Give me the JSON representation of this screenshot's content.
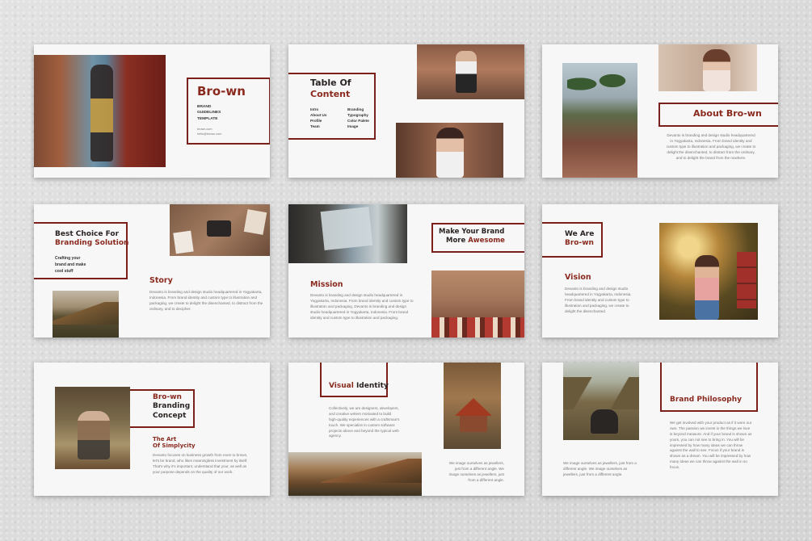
{
  "colors": {
    "accent": "#7a1f1a",
    "accent_text": "#8a2a1f",
    "dark_text": "#2a2322",
    "slide_bg": "#f7f7f7",
    "backdrop": "#dcdcdc"
  },
  "slide1": {
    "title": "Bro-wn",
    "subtitle_lines": [
      "BRAND",
      "GUIDELINES",
      "TEMPLATE"
    ],
    "website": "brown.com",
    "email": "hello@brown.com",
    "photo_alt": "woman-on-shipping-containers-photo"
  },
  "slide2": {
    "title_line1": "Table Of",
    "title_line2": "Content",
    "col1": [
      "Intro",
      "About Us",
      "Profile",
      "Team"
    ],
    "col2": [
      "Branding",
      "Typography",
      "Color Palete",
      "Image"
    ]
  },
  "slide3": {
    "title_prefix": "About ",
    "title_brand": "Bro-wn",
    "body": "Devanto is branding and design studio headquartered in Yogyakarta, Indonesia. From brand identity and custom type to illustration and packaging, we create to delight the disenchanted, to distract from the ordinary, and to delight the brand from the nowhere."
  },
  "slide4": {
    "title_line1": "Best Choice For",
    "title_line2": "Branding Solution",
    "tagline": "Crafting your brand and make cool stuff",
    "heading": "Story",
    "body": "Devanto is branding and design studio headquartered in Yogyakarta, Indonesia. From brand identity and custom type to illustration and packaging, we create to delight the disenchanted, to distract from the ordinary, and to decipher."
  },
  "slide5": {
    "title_line1": "Make Your Brand",
    "title_plain": "More ",
    "title_accent": "Awesome",
    "heading": "Mission",
    "body": "Devanto is branding and design studio headquartered in Yogyakarta, Indonesia. From brand identity and custom type to illustration and packaging. Devanto is branding and design studio headquartered in Yogyakarta, Indonesia. From brand identity and custom type to illustration and packaging."
  },
  "slide6": {
    "title_line1": "We Are",
    "title_line2": "Bro-wn",
    "heading": "Vision",
    "body": "Devanto is branding and design studio headquartered in Yogyakarta, Indonesia. From brand identity and custom type to illustration and packaging, we create to delight the disenchanted."
  },
  "slide7": {
    "title_line1": "Bro-wn",
    "title_line2": "Branding",
    "title_line3": "Concept",
    "subheading_line1": "The Art",
    "subheading_line2": "Of Simplycity",
    "body": "Devanto focuses on business growth from room to brown, let's be brand, who likes meaningless investment by itself. That's why it's important. understand that your, as well as your purpose depends on the quality of our work."
  },
  "slide8": {
    "title_accent": "Visual ",
    "title_plain": "Identity",
    "body": "Collectively, we are designers, developers, and creative writers motivated to build high-quality experiences with a craftsman's touch. We specialize in custom software projects above and beyond the typical web agency.",
    "caption": "We image ourselves as jewellers, just from a different angle. We image ourselves as jewellers, just from a different angle."
  },
  "slide9": {
    "title": "Brand Philosophy",
    "body": "We get involved with your product as if it were our own. The passion we invest in the things we love is beyond measure. And if your brand is shown as yours, you can not see to bring in. You will be impressed by how many ideas we can throw against the wall to see. Focus if your brand is shown as a dream. You will be impressed by how many ideas we can throw against the wall in so focus.",
    "caption": "We image ourselves as jewellers, just from a different angle. We image ourselves as jewellers, just from a different angle."
  }
}
